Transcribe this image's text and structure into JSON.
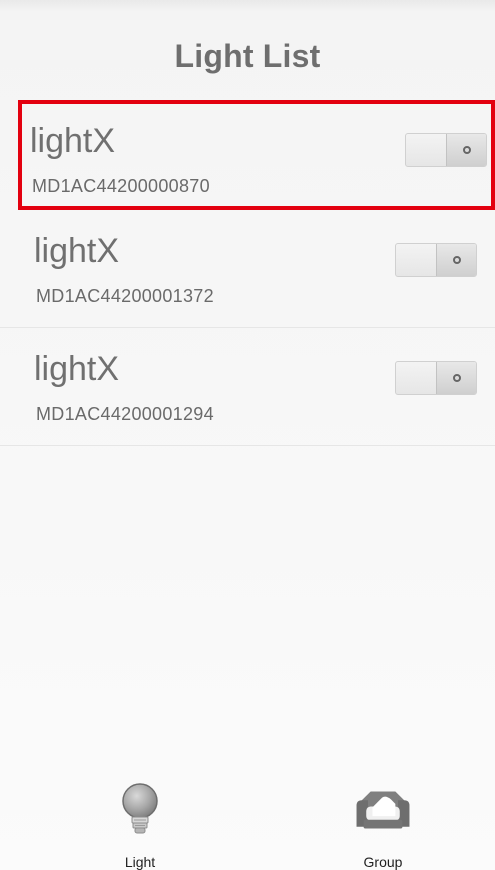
{
  "header": {
    "title": "Light List"
  },
  "lights": [
    {
      "name": "lightX",
      "serial": "MD1AC44200000870"
    },
    {
      "name": "lightX",
      "serial": "MD1AC44200001372"
    },
    {
      "name": "lightX",
      "serial": "MD1AC44200001294"
    }
  ],
  "nav": {
    "tabs": [
      {
        "label": "Light",
        "icon": "light-bulb-icon"
      },
      {
        "label": "Group",
        "icon": "group-sofa-icon"
      }
    ]
  },
  "colors": {
    "selection_outline": "#e3000f",
    "text": "#707070",
    "background": "#f5f5f5"
  }
}
